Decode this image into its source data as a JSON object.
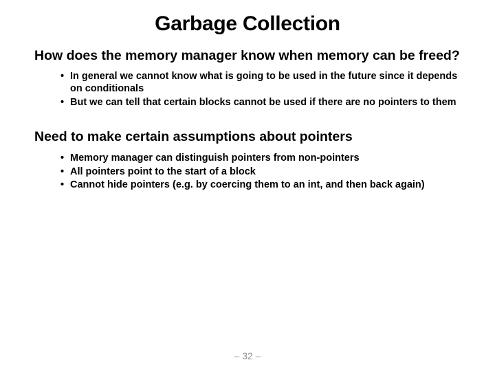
{
  "title": "Garbage Collection",
  "section1": "How does the memory manager know when memory can be freed?",
  "bullets1": [
    "In general we cannot know what is going to be used in the future since it depends on conditionals",
    "But we can tell that certain blocks cannot be used if there are no pointers to them"
  ],
  "section2": "Need to make certain assumptions about pointers",
  "bullets2": [
    "Memory manager can distinguish pointers from non-pointers",
    "All pointers point to the start of a block",
    "Cannot hide pointers (e.g. by coercing them to an int, and then back again)"
  ],
  "page": "– 32 –"
}
